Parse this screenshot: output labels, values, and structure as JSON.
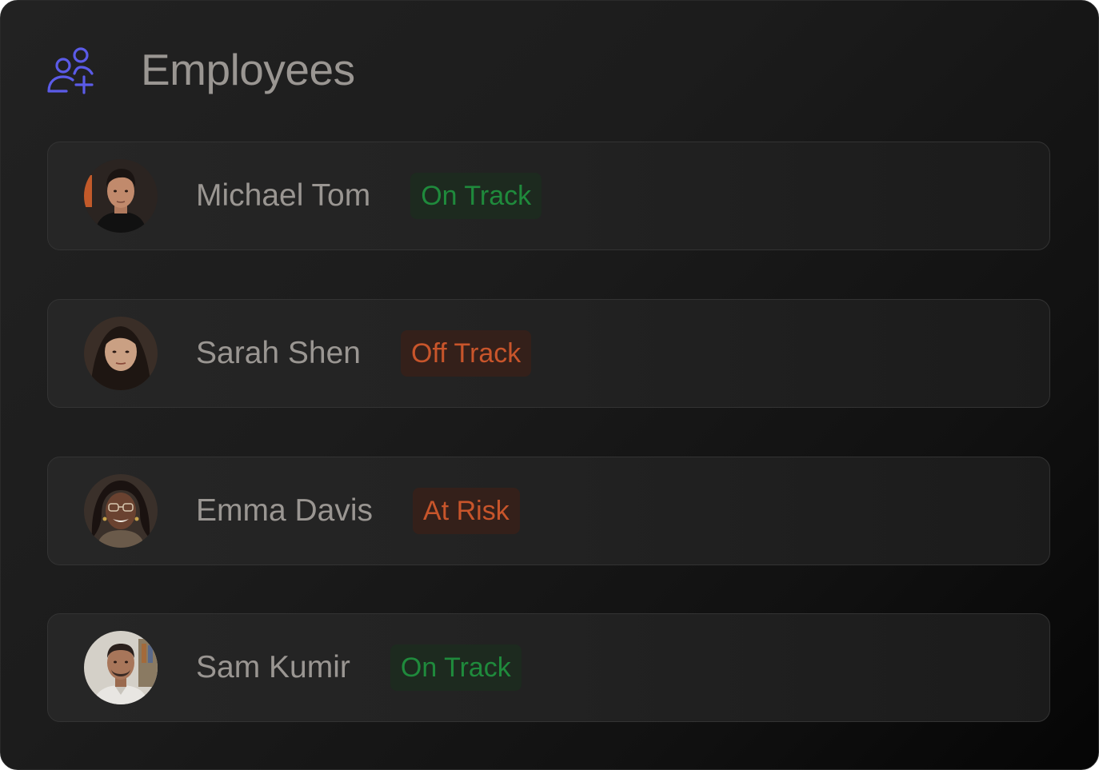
{
  "header": {
    "title": "Employees",
    "icon": "users-add-icon",
    "icon_color": "#5b5be8"
  },
  "status_colors": {
    "on_track": "#1f8a3c",
    "off_track": "#c8552b",
    "at_risk": "#c8552b"
  },
  "employees": [
    {
      "name": "Michael Tom",
      "status": "On Track",
      "status_type": "green"
    },
    {
      "name": "Sarah Shen",
      "status": "Off Track",
      "status_type": "orange"
    },
    {
      "name": "Emma Davis",
      "status": "At Risk",
      "status_type": "orange"
    },
    {
      "name": "Sam Kumir",
      "status": "On Track",
      "status_type": "green"
    }
  ]
}
